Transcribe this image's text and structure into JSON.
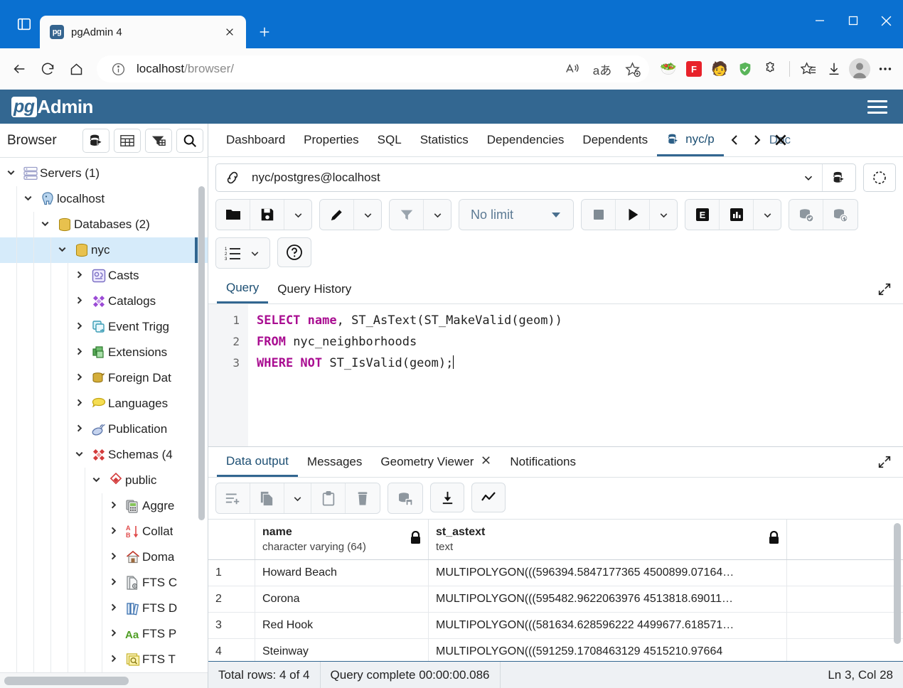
{
  "browser": {
    "tab_title": "pgAdmin 4",
    "favicon_text": "pg",
    "url_host": "localhost",
    "url_path": "/browser/",
    "new_tab_label": "+",
    "icons": {
      "tab_actions": "tab-actions-icon",
      "back": "back-arrow-icon",
      "reload": "reload-icon",
      "home": "home-icon",
      "info": "info-icon",
      "read_aloud": "read-aloud-icon",
      "translate": "translate-icon",
      "favorite": "add-favorite-icon",
      "collections": "collections-icon",
      "downloads": "downloads-icon",
      "settings": "settings-more-icon"
    },
    "extensions": [
      "🥗",
      "🅵️",
      "🧑",
      "🛡️",
      "🧩"
    ],
    "window": {
      "minimize": "minimize-icon",
      "maximize": "maximize-icon",
      "close": "close-icon"
    }
  },
  "pgadmin": {
    "logo_mark": "pg",
    "logo_text": "Admin",
    "menu_icon": "hamburger-menu-icon"
  },
  "sidebar": {
    "title": "Browser",
    "buttons": [
      {
        "name": "object-explorer-button",
        "icon": "database-run-icon"
      },
      {
        "name": "grid-view-button",
        "icon": "table-icon"
      },
      {
        "name": "filter-button",
        "icon": "filter-table-icon"
      },
      {
        "name": "search-button",
        "icon": "search-icon"
      }
    ],
    "tree": [
      {
        "label": "Servers (1)",
        "depth": 0,
        "state": "open",
        "icon": "servers-icon",
        "selected": false
      },
      {
        "label": "localhost",
        "depth": 1,
        "state": "open",
        "icon": "postgres-elephant-icon",
        "selected": false
      },
      {
        "label": "Databases (2)",
        "depth": 2,
        "state": "open",
        "icon": "databases-icon",
        "selected": false
      },
      {
        "label": "nyc",
        "depth": 3,
        "state": "open",
        "icon": "database-icon",
        "selected": true
      },
      {
        "label": "Casts",
        "depth": 4,
        "state": "closed",
        "icon": "casts-icon",
        "selected": false
      },
      {
        "label": "Catalogs",
        "depth": 4,
        "state": "closed",
        "icon": "catalogs-icon",
        "selected": false
      },
      {
        "label": "Event Trigg",
        "depth": 4,
        "state": "closed",
        "icon": "event-triggers-icon",
        "selected": false
      },
      {
        "label": "Extensions",
        "depth": 4,
        "state": "closed",
        "icon": "extensions-icon",
        "selected": false
      },
      {
        "label": "Foreign Dat",
        "depth": 4,
        "state": "closed",
        "icon": "foreign-data-wrappers-icon",
        "selected": false
      },
      {
        "label": "Languages",
        "depth": 4,
        "state": "closed",
        "icon": "languages-icon",
        "selected": false
      },
      {
        "label": "Publication",
        "depth": 4,
        "state": "closed",
        "icon": "publications-icon",
        "selected": false
      },
      {
        "label": "Schemas (4",
        "depth": 4,
        "state": "open",
        "icon": "schemas-icon",
        "selected": false
      },
      {
        "label": "public",
        "depth": 5,
        "state": "open",
        "icon": "schema-icon",
        "selected": false
      },
      {
        "label": "Aggre",
        "depth": 6,
        "state": "closed",
        "icon": "aggregates-icon",
        "selected": false
      },
      {
        "label": "Collat",
        "depth": 6,
        "state": "closed",
        "icon": "collations-icon",
        "selected": false
      },
      {
        "label": "Doma",
        "depth": 6,
        "state": "closed",
        "icon": "domains-icon",
        "selected": false
      },
      {
        "label": "FTS C",
        "depth": 6,
        "state": "closed",
        "icon": "fts-configurations-icon",
        "selected": false
      },
      {
        "label": "FTS D",
        "depth": 6,
        "state": "closed",
        "icon": "fts-dictionaries-icon",
        "selected": false
      },
      {
        "label": "FTS P",
        "depth": 6,
        "state": "closed",
        "icon": "fts-parsers-icon",
        "selected": false
      },
      {
        "label": "FTS T",
        "depth": 6,
        "state": "closed",
        "icon": "fts-templates-icon",
        "selected": false
      }
    ]
  },
  "object_tabs": {
    "items": [
      "Dashboard",
      "Properties",
      "SQL",
      "Statistics",
      "Dependencies",
      "Dependents"
    ],
    "active_query_tab": "nyc/p",
    "nav": {
      "prev": "chevron-left-icon",
      "next": "chevron-right-icon",
      "close": "close-icon"
    }
  },
  "connection": {
    "value": "nyc/postgres@localhost",
    "link_icon": "connection-link-icon",
    "caret_icon": "chevron-down-icon",
    "db_icon": "database-run-icon",
    "refresh_icon": "reset-icon"
  },
  "query_toolbar": {
    "open_file": "open-file-icon",
    "save_file": "save-file-icon",
    "save_caret": "chevron-down-icon",
    "edit": "edit-pencil-icon",
    "edit_caret": "chevron-down-icon",
    "filter": "filter-icon",
    "filter_caret": "chevron-down-icon",
    "limit_label": "No limit",
    "limit_caret": "caret-down-icon",
    "stop": "stop-icon",
    "execute": "execute-play-icon",
    "execute_caret": "chevron-down-icon",
    "explain": "explain-e-icon",
    "analyze": "explain-analyze-chart-icon",
    "explain_caret": "chevron-down-icon",
    "commit": "commit-icon",
    "rollback": "rollback-icon",
    "macros": "macros-list-icon",
    "macros_caret": "chevron-down-icon",
    "help": "help-question-icon"
  },
  "query_panel": {
    "tabs": [
      "Query",
      "Query History"
    ],
    "active_tab": "Query",
    "expand_icon": "expand-panel-icon",
    "line_numbers": [
      "1",
      "2",
      "3"
    ],
    "sql_lines": [
      [
        {
          "t": "SELECT",
          "k": true
        },
        {
          "t": " ",
          "k": false
        },
        {
          "t": "name",
          "k": true
        },
        {
          "t": ", ST_AsText(ST_MakeValid(geom))",
          "k": false
        }
      ],
      [
        {
          "t": "FROM",
          "k": true
        },
        {
          "t": " nyc_neighborhoods",
          "k": false
        }
      ],
      [
        {
          "t": "WHERE NOT",
          "k": true
        },
        {
          "t": " ST_IsValid(geom);",
          "k": false
        }
      ]
    ]
  },
  "output_panel": {
    "tabs": [
      {
        "label": "Data output",
        "closable": false,
        "active": true
      },
      {
        "label": "Messages",
        "closable": false,
        "active": false
      },
      {
        "label": "Geometry Viewer",
        "closable": true,
        "active": false
      },
      {
        "label": "Notifications",
        "closable": false,
        "active": false
      }
    ],
    "expand_icon": "expand-panel-icon",
    "toolbar": {
      "add_row": "add-row-icon",
      "copy": "copy-icon",
      "copy_caret": "chevron-down-icon",
      "paste": "paste-icon",
      "delete": "delete-trash-icon",
      "save_data": "save-data-changes-icon",
      "download": "download-csv-icon",
      "graph": "graph-visualiser-icon"
    },
    "columns": [
      {
        "name": "name",
        "type": "character varying (64)",
        "locked": true
      },
      {
        "name": "st_astext",
        "type": "text",
        "locked": true
      }
    ],
    "rows": [
      {
        "num": "1",
        "name": "Howard Beach",
        "st_astext": "MULTIPOLYGON(((596394.5847177365 4500899.07164…"
      },
      {
        "num": "2",
        "name": "Corona",
        "st_astext": "MULTIPOLYGON(((595482.9622063976 4513818.69011…"
      },
      {
        "num": "3",
        "name": "Red Hook",
        "st_astext": "MULTIPOLYGON(((581634.628596222 4499677.618571…"
      },
      {
        "num": "4",
        "name": "Steinway",
        "st_astext": "MULTIPOLYGON(((591259.1708463129 4515210.97664"
      }
    ]
  },
  "statusbar": {
    "total_rows": "Total rows: 4 of 4",
    "query_status": "Query complete 00:00:00.086",
    "cursor": "Ln 3, Col 28"
  },
  "colors": {
    "brand": "#336791",
    "accent": "#326690",
    "browser_blue": "#0a70d0",
    "selection": "#d6ebfa",
    "keyword": "#a90d91"
  }
}
